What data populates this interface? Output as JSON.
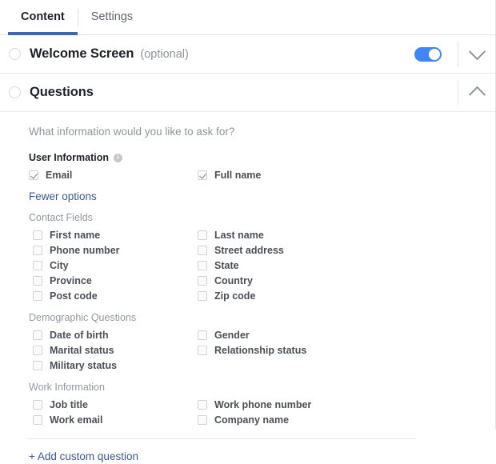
{
  "tabs": [
    {
      "label": "Content",
      "active": true
    },
    {
      "label": "Settings",
      "active": false
    }
  ],
  "sections": {
    "welcome": {
      "title": "Welcome Screen",
      "optional_label": "(optional)",
      "toggle_on": true,
      "chevron": "chevron-down"
    },
    "questions": {
      "title": "Questions",
      "chevron": "chevron-up",
      "prompt": "What information would you like to ask for?"
    }
  },
  "questions_body": {
    "user_information": {
      "title": "User Information",
      "info_icon": "info-icon",
      "fields": [
        {
          "label": "Email",
          "checked": true,
          "column": "left"
        },
        {
          "label": "Full name",
          "checked": true,
          "column": "right"
        }
      ]
    },
    "fewer_options_link": "Fewer options",
    "groups": [
      {
        "title": "Contact Fields",
        "rows": [
          {
            "left": "First name",
            "right": "Last name"
          },
          {
            "left": "Phone number",
            "right": "Street address"
          },
          {
            "left": "City",
            "right": "State"
          },
          {
            "left": "Province",
            "right": "Country"
          },
          {
            "left": "Post code",
            "right": "Zip code"
          }
        ]
      },
      {
        "title": "Demographic Questions",
        "rows": [
          {
            "left": "Date of birth",
            "right": "Gender"
          },
          {
            "left": "Marital status",
            "right": "Relationship status"
          },
          {
            "left": "Military status",
            "right": ""
          }
        ]
      },
      {
        "title": "Work Information",
        "rows": [
          {
            "left": "Job title",
            "right": "Work phone number"
          },
          {
            "left": "Work email",
            "right": "Company name"
          }
        ]
      }
    ],
    "add_custom_question": "+ Add custom question"
  },
  "colors": {
    "accent_tab": "#4267b2",
    "toggle_on": "#4285f4",
    "link": "#3b5998",
    "muted_text": "#90949c",
    "label_text": "#4b4f56"
  }
}
